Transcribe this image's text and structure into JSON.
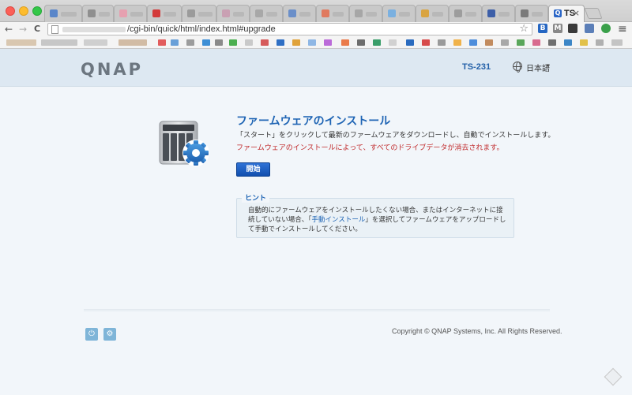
{
  "browser": {
    "tab_title": "TS",
    "tab_close": "×",
    "url": "/cgi-bin/quick/html/index.html#upgrade",
    "back_glyph": "←",
    "forward_glyph": "→",
    "reload_glyph": "C",
    "star_glyph": "☆",
    "menu_glyph": "≡"
  },
  "header": {
    "logo": "QNAP",
    "model": "TS-231",
    "language": "日本語",
    "caret": "▾"
  },
  "main": {
    "title": "ファームウェアのインストール",
    "description": "「スタート」をクリックして最新のファームウェアをダウンロードし、自動でインストールします。",
    "warning": "ファームウェアのインストールによって、すべてのドライブデータが消去されます。",
    "start_button": "開始"
  },
  "hint": {
    "title": "ヒント",
    "text_before": "自動的にファームウェアをインストールしたくない場合、またはインターネットに接続していない場合、「",
    "link": "手動インストール",
    "text_after": "」を選択してファームウェアをアップロードして手動でインストールしてください。"
  },
  "footer": {
    "copyright": "Copyright © QNAP Systems, Inc. All Rights Reserved.",
    "power_glyph": "⏻",
    "settings_glyph": "⚙"
  }
}
